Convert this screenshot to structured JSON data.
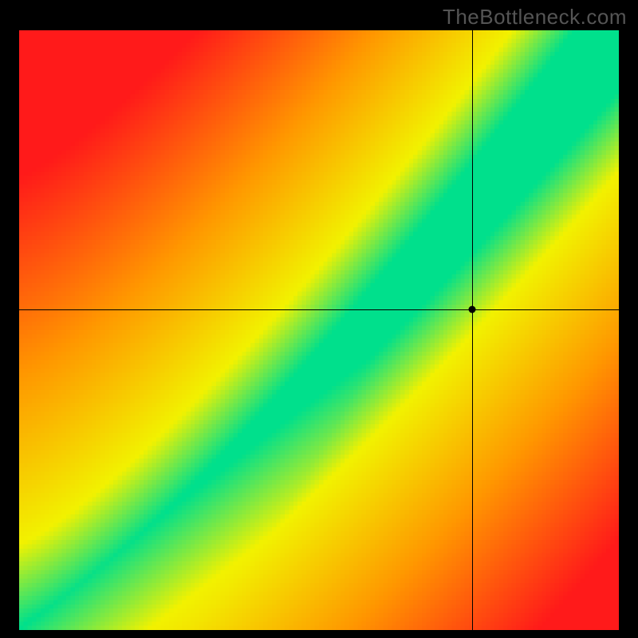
{
  "watermark": "TheBottleneck.com",
  "chart_data": {
    "type": "heatmap",
    "title": "",
    "xlabel": "",
    "ylabel": "",
    "xlim": [
      0,
      1
    ],
    "ylim": [
      0,
      1
    ],
    "crosshair": {
      "x": 0.755,
      "y": 0.535
    },
    "marker": {
      "x": 0.755,
      "y": 0.535
    },
    "optimal_ratio_curve": {
      "description": "green optimal band follows y ≈ x^1.25 with band width growing toward top-right",
      "exponent": 1.25,
      "band_start_width": 0.008,
      "band_end_width": 0.1
    },
    "color_scale": {
      "center": "#00E08C",
      "near": "#F2F200",
      "mid": "#FF9900",
      "far": "#FF1A1A"
    },
    "resolution": 140
  }
}
